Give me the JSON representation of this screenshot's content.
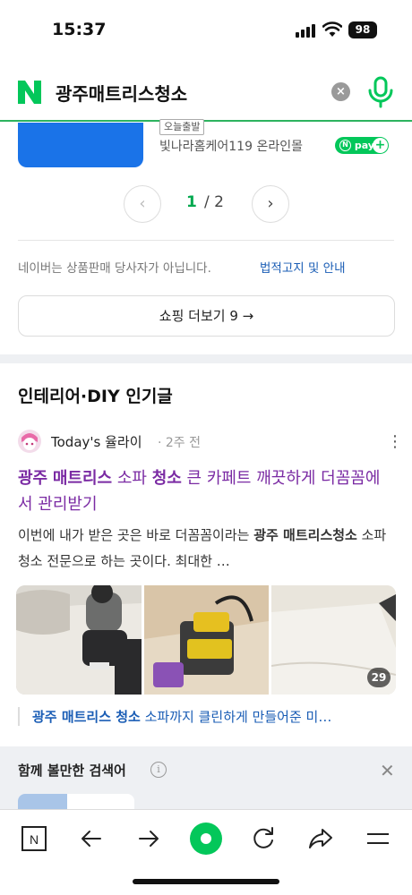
{
  "status": {
    "time": "15:37",
    "battery": "98"
  },
  "search": {
    "query": "광주매트리스청소",
    "logo": "N"
  },
  "shopping": {
    "badge": "오늘출발",
    "seller": "빛나라홈케어119 온라인몰",
    "npay": "pay",
    "page_current": "1",
    "page_sep": "/ 2",
    "notice": "네이버는 상품판매 당사자가 아닙니다.",
    "notice_link": "법적고지 및 안내",
    "more_button": "쇼핑 더보기 9 →"
  },
  "interior": {
    "section_title": "인테리어·DIY 인기글",
    "author": "Today's 율라이",
    "time": "· 2주 전",
    "title_parts": [
      "광주",
      " ",
      "매트리스",
      " 소파 ",
      "청소",
      " 큰 카페트 깨끗하게 더꼼꼼에서 관리받기"
    ],
    "body_parts": [
      "이번에 내가 받은 곳은 바로 더꼼꼼이라는 ",
      "광주 매트리스청소",
      " 소파청소 전문으로 하는 곳이다. 최대한 …"
    ],
    "photo_count": "29",
    "related_parts": [
      "광주 매트리스 청소",
      " 소파까지 클린하게 만들어준 미…"
    ]
  },
  "cosearch": {
    "title": "함께 볼만한 검색어",
    "info": "i"
  },
  "toolbar": {
    "home": "N"
  },
  "colors": {
    "naver_green": "#03c75a",
    "post_title": "#7a2aa3",
    "link_blue": "#1a5db5"
  }
}
